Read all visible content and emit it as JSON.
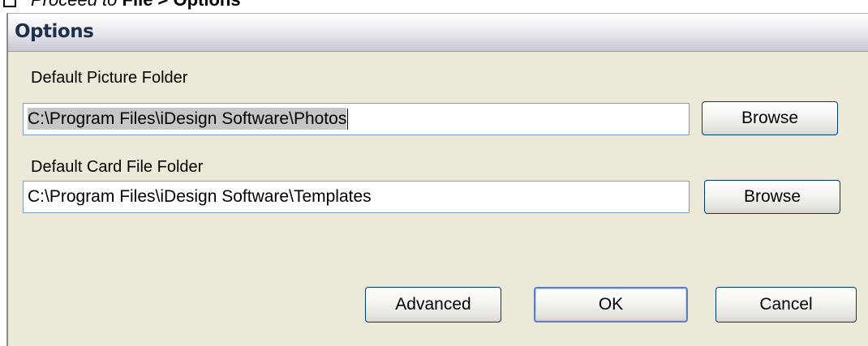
{
  "caption": {
    "prefix": "Proceed to",
    "menu_path": "File > Options"
  },
  "dialog": {
    "title": "Options",
    "picture_folder": {
      "label": "Default Picture Folder",
      "value": "C:\\Program Files\\iDesign Software\\Photos",
      "browse_label": "Browse"
    },
    "card_folder": {
      "label": "Default Card File Folder",
      "value": "C:\\Program Files\\iDesign Software\\Templates",
      "browse_label": "Browse"
    },
    "buttons": {
      "advanced": "Advanced",
      "ok": "OK",
      "cancel": "Cancel"
    }
  }
}
